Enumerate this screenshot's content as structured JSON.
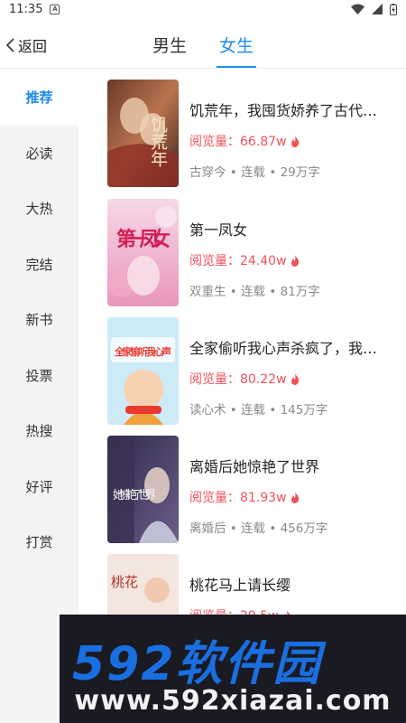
{
  "status_bar": {
    "time": "11:35",
    "notification_badge": "A"
  },
  "header": {
    "back_label": "返回",
    "tabs": [
      {
        "label": "男生",
        "active": false
      },
      {
        "label": "女生",
        "active": true
      }
    ]
  },
  "sidebar": {
    "items": [
      {
        "label": "推荐",
        "active": true
      },
      {
        "label": "必读",
        "active": false
      },
      {
        "label": "大热",
        "active": false
      },
      {
        "label": "完结",
        "active": false
      },
      {
        "label": "新书",
        "active": false
      },
      {
        "label": "投票",
        "active": false
      },
      {
        "label": "热搜",
        "active": false
      },
      {
        "label": "好评",
        "active": false
      },
      {
        "label": "打赏",
        "active": false
      }
    ]
  },
  "books": [
    {
      "title": "饥荒年，我囤货娇养了古代…",
      "views": "阅览量：66.87w",
      "meta": "古穿今 • 连载 • 29万字",
      "cover_text": "饥荒年"
    },
    {
      "title": "第一凤女",
      "views": "阅览量：24.40w",
      "meta": "双重生 • 连载 • 81万字",
      "cover_text": "第一凤女"
    },
    {
      "title": "全家偷听我心声杀疯了，我…",
      "views": "阅览量：80.22w",
      "meta": "读心术 • 连载 • 145万字",
      "cover_text": "全家偷听我心声"
    },
    {
      "title": "离婚后她惊艳了世界",
      "views": "阅览量：81.93w",
      "meta": "离婚后 • 连载 • 456万字",
      "cover_text": "她惊艳了世界"
    },
    {
      "title": "桃花马上请长缨",
      "views": "阅览量：29.5w",
      "meta": "",
      "cover_text": "桃花"
    }
  ],
  "watermark": {
    "brand": "592软件园",
    "url": "www.592xiazai.com"
  },
  "colors": {
    "accent": "#1e8be8",
    "views_red": "#f0525a",
    "meta_gray": "#8a8a8a"
  }
}
